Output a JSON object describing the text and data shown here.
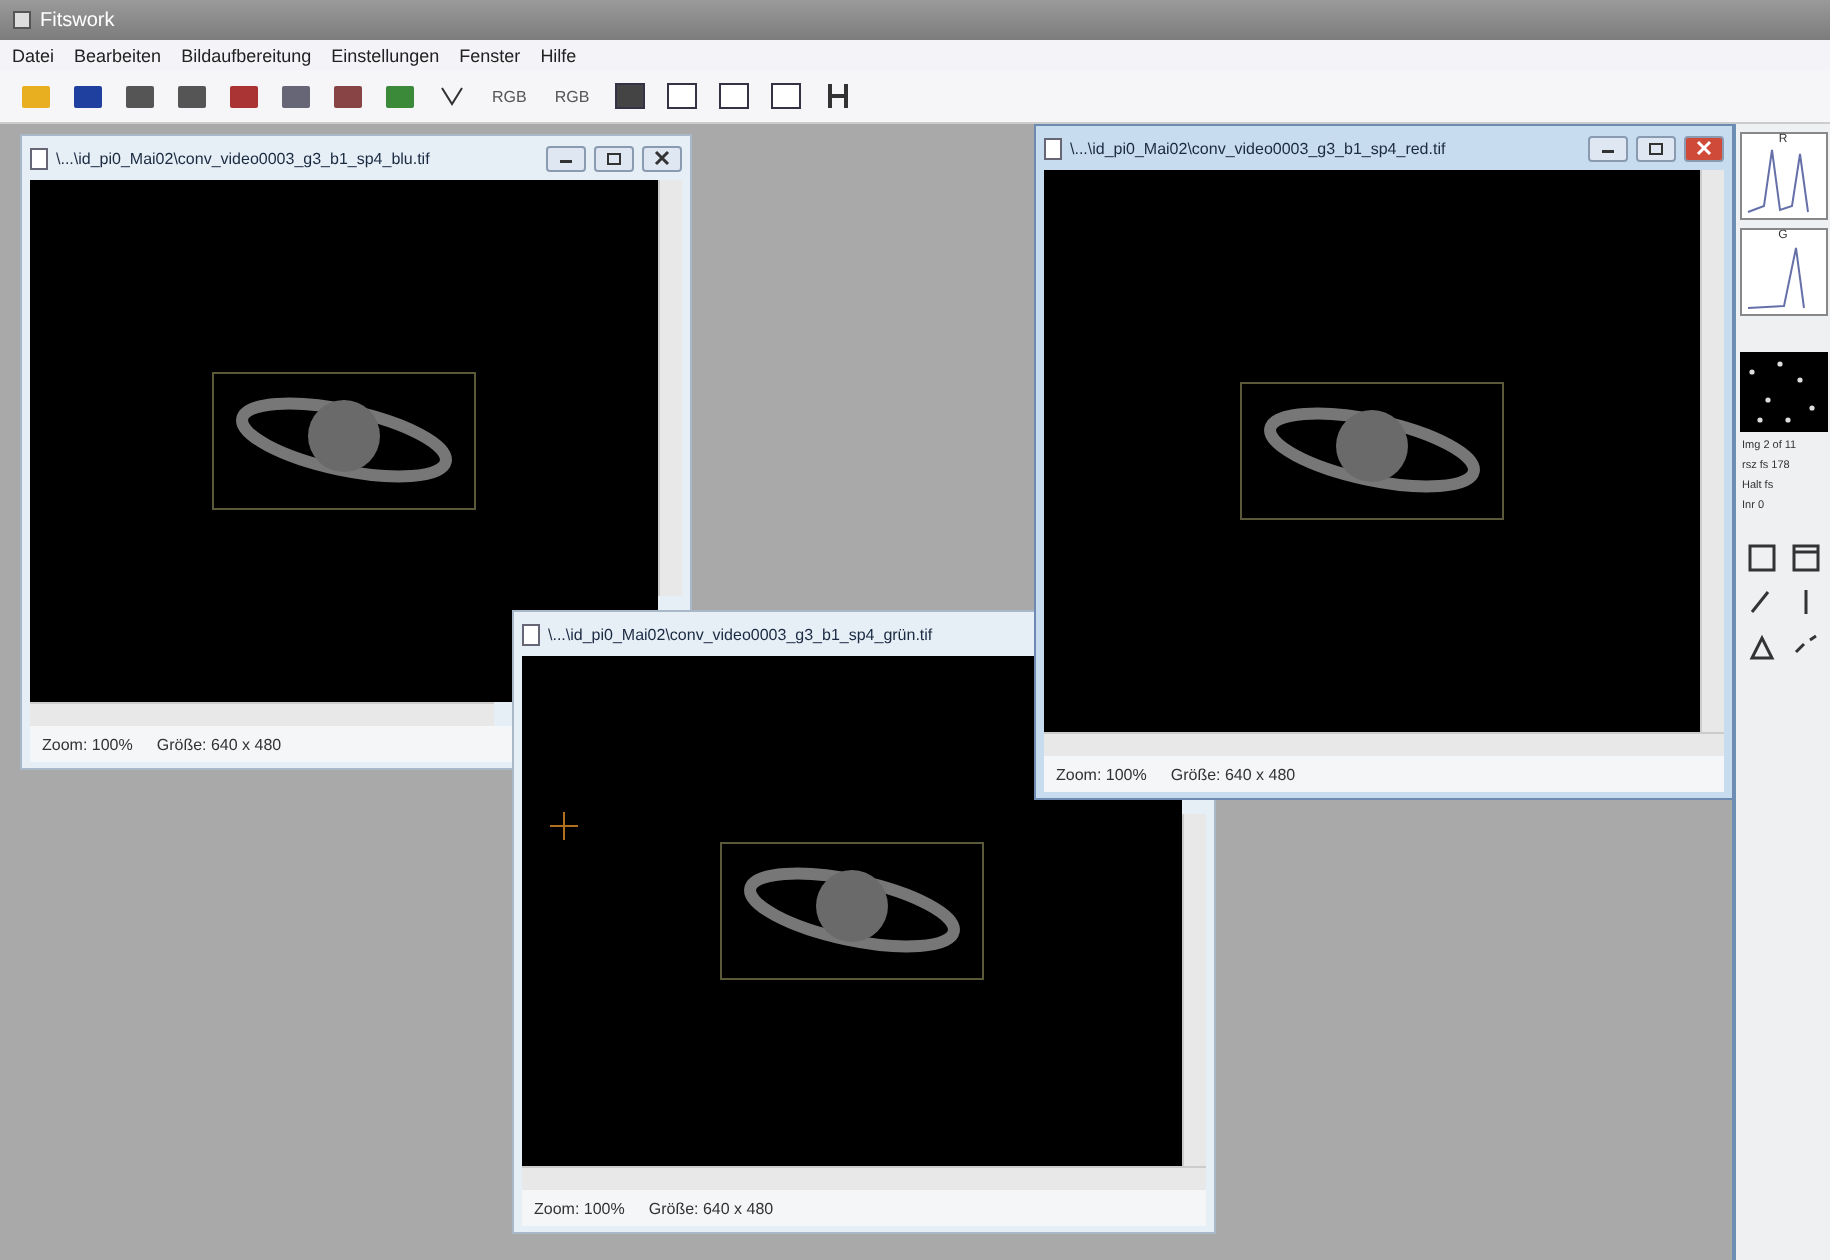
{
  "app": {
    "title": "Fitswork"
  },
  "menu": [
    "Datei",
    "Bearbeiten",
    "Bildaufbereitung",
    "Einstellungen",
    "Fenster",
    "Hilfe"
  ],
  "toolbar_text_buttons": [
    "RGB",
    "RGB"
  ],
  "windows": [
    {
      "title": "\\...\\id_pi0_Mai02\\conv_video0003_g3_b1_sp4_blu.tif",
      "active": false,
      "crosshair": false,
      "zoom": "Zoom: 100%",
      "size": "Größe: 640 x 480"
    },
    {
      "title": "\\...\\id_pi0_Mai02\\conv_video0003_g3_b1_sp4_red.tif",
      "active": true,
      "crosshair": false,
      "zoom": "Zoom: 100%",
      "size": "Größe: 640 x 480"
    },
    {
      "title": "\\...\\id_pi0_Mai02\\conv_video0003_g3_b1_sp4_grün.tif",
      "active": false,
      "crosshair": true,
      "zoom": "Zoom: 100%",
      "size": "Größe: 640 x 480"
    }
  ],
  "side_panel": {
    "histogram_labels": [
      "R",
      "G"
    ],
    "info": [
      "Img 2 of 11",
      "rsz fs 178",
      "Halt fs",
      "Inr 0"
    ]
  }
}
